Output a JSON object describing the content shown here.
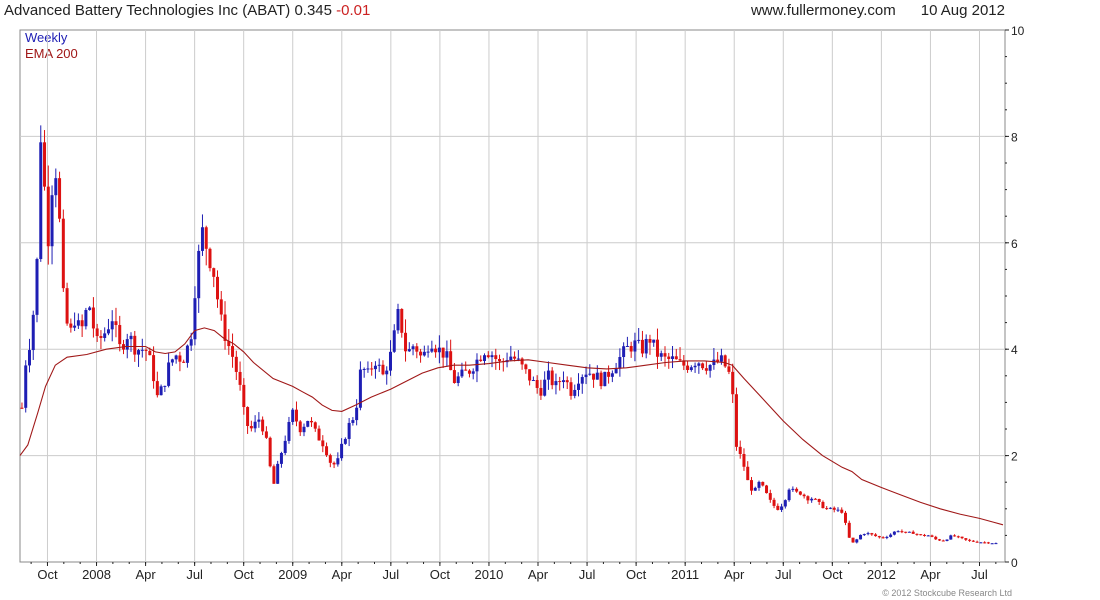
{
  "header": {
    "company": "Advanced Battery Technologies Inc (ABAT)",
    "price": "0.345",
    "change": "-0.01",
    "website": "www.fullermoney.com",
    "date": "10 Aug 2012"
  },
  "legend": {
    "period": "Weekly",
    "ema": "EMA 200"
  },
  "copyright": "© 2012 Stockcube Research Ltd",
  "colors": {
    "up": "#1e1eb4",
    "down": "#dd1111",
    "ema": "#a01818",
    "grid": "#cccccc",
    "axis": "#222222"
  },
  "chart_data": {
    "type": "candlestick",
    "series": [
      {
        "name": "Weekly",
        "kind": "ohlc"
      },
      {
        "name": "EMA 200",
        "kind": "line"
      }
    ],
    "y_axis": {
      "side": "right",
      "min": 0,
      "max": 10,
      "ticks": [
        0,
        2,
        4,
        6,
        8,
        10
      ]
    },
    "x_axis": {
      "ticks": [
        {
          "label": "Oct",
          "year": 2007.75
        },
        {
          "label": "2008",
          "year": 2008.0
        },
        {
          "label": "Apr",
          "year": 2008.25
        },
        {
          "label": "Jul",
          "year": 2008.5
        },
        {
          "label": "Oct",
          "year": 2008.75
        },
        {
          "label": "2009",
          "year": 2009.0
        },
        {
          "label": "Apr",
          "year": 2009.25
        },
        {
          "label": "Jul",
          "year": 2009.5
        },
        {
          "label": "Oct",
          "year": 2009.75
        },
        {
          "label": "2010",
          "year": 2010.0
        },
        {
          "label": "Apr",
          "year": 2010.25
        },
        {
          "label": "Jul",
          "year": 2010.5
        },
        {
          "label": "Oct",
          "year": 2010.75
        },
        {
          "label": "2011",
          "year": 2011.0
        },
        {
          "label": "Apr",
          "year": 2011.25
        },
        {
          "label": "Jul",
          "year": 2011.5
        },
        {
          "label": "Oct",
          "year": 2011.75
        },
        {
          "label": "2012",
          "year": 2012.0
        },
        {
          "label": "Apr",
          "year": 2012.25
        },
        {
          "label": "Jul",
          "year": 2012.5
        }
      ]
    },
    "close_path": [
      [
        2007.62,
        2.9
      ],
      [
        2007.64,
        3.8
      ],
      [
        2007.67,
        4.3
      ],
      [
        2007.7,
        5.8
      ],
      [
        2007.71,
        8.3
      ],
      [
        2007.73,
        7.4
      ],
      [
        2007.75,
        5.9
      ],
      [
        2007.77,
        7.0
      ],
      [
        2007.79,
        7.5
      ],
      [
        2007.81,
        6.5
      ],
      [
        2007.83,
        5.0
      ],
      [
        2007.86,
        4.2
      ],
      [
        2007.89,
        4.6
      ],
      [
        2007.92,
        4.3
      ],
      [
        2007.96,
        4.9
      ],
      [
        2008.0,
        4.1
      ],
      [
        2008.04,
        4.3
      ],
      [
        2008.08,
        4.6
      ],
      [
        2008.12,
        4.0
      ],
      [
        2008.16,
        4.3
      ],
      [
        2008.2,
        4.0
      ],
      [
        2008.25,
        4.0
      ],
      [
        2008.28,
        3.7
      ],
      [
        2008.31,
        3.1
      ],
      [
        2008.34,
        3.3
      ],
      [
        2008.37,
        3.7
      ],
      [
        2008.4,
        3.9
      ],
      [
        2008.44,
        3.8
      ],
      [
        2008.48,
        4.2
      ],
      [
        2008.51,
        5.5
      ],
      [
        2008.54,
        6.2
      ],
      [
        2008.57,
        5.8
      ],
      [
        2008.6,
        5.4
      ],
      [
        2008.63,
        4.6
      ],
      [
        2008.66,
        4.2
      ],
      [
        2008.7,
        3.8
      ],
      [
        2008.73,
        3.3
      ],
      [
        2008.76,
        2.6
      ],
      [
        2008.79,
        2.5
      ],
      [
        2008.83,
        2.7
      ],
      [
        2008.86,
        2.4
      ],
      [
        2008.9,
        1.4
      ],
      [
        2008.93,
        1.9
      ],
      [
        2008.96,
        2.3
      ],
      [
        2009.0,
        2.8
      ],
      [
        2009.04,
        2.5
      ],
      [
        2009.08,
        2.7
      ],
      [
        2009.12,
        2.4
      ],
      [
        2009.16,
        2.2
      ],
      [
        2009.2,
        1.8
      ],
      [
        2009.23,
        1.9
      ],
      [
        2009.26,
        2.3
      ],
      [
        2009.29,
        2.6
      ],
      [
        2009.32,
        2.8
      ],
      [
        2009.35,
        3.7
      ],
      [
        2009.38,
        3.5
      ],
      [
        2009.42,
        3.8
      ],
      [
        2009.46,
        3.5
      ],
      [
        2009.5,
        3.9
      ],
      [
        2009.54,
        4.7
      ],
      [
        2009.58,
        3.9
      ],
      [
        2009.62,
        4.1
      ],
      [
        2009.66,
        3.8
      ],
      [
        2009.7,
        4.2
      ],
      [
        2009.74,
        4.0
      ],
      [
        2009.78,
        3.9
      ],
      [
        2009.82,
        3.4
      ],
      [
        2009.86,
        3.5
      ],
      [
        2009.9,
        3.6
      ],
      [
        2009.94,
        3.8
      ],
      [
        2009.98,
        4.0
      ],
      [
        2010.02,
        3.9
      ],
      [
        2010.06,
        3.7
      ],
      [
        2010.1,
        3.9
      ],
      [
        2010.14,
        3.8
      ],
      [
        2010.18,
        3.6
      ],
      [
        2010.22,
        3.4
      ],
      [
        2010.26,
        3.2
      ],
      [
        2010.3,
        3.5
      ],
      [
        2010.34,
        3.3
      ],
      [
        2010.38,
        3.5
      ],
      [
        2010.42,
        3.2
      ],
      [
        2010.46,
        3.5
      ],
      [
        2010.5,
        3.6
      ],
      [
        2010.54,
        3.5
      ],
      [
        2010.58,
        3.4
      ],
      [
        2010.62,
        3.6
      ],
      [
        2010.66,
        3.8
      ],
      [
        2010.7,
        4.0
      ],
      [
        2010.74,
        4.1
      ],
      [
        2010.78,
        4.0
      ],
      [
        2010.82,
        4.2
      ],
      [
        2010.86,
        3.9
      ],
      [
        2010.9,
        3.8
      ],
      [
        2010.94,
        3.8
      ],
      [
        2010.98,
        3.7
      ],
      [
        2011.02,
        3.7
      ],
      [
        2011.06,
        3.8
      ],
      [
        2011.1,
        3.7
      ],
      [
        2011.14,
        3.7
      ],
      [
        2011.18,
        3.8
      ],
      [
        2011.22,
        3.6
      ],
      [
        2011.24,
        3.2
      ],
      [
        2011.26,
        2.2
      ],
      [
        2011.28,
        2.0
      ],
      [
        2011.3,
        1.8
      ],
      [
        2011.32,
        1.5
      ],
      [
        2011.35,
        1.3
      ],
      [
        2011.38,
        1.5
      ],
      [
        2011.41,
        1.3
      ],
      [
        2011.44,
        1.1
      ],
      [
        2011.47,
        1.0
      ],
      [
        2011.5,
        1.1
      ],
      [
        2011.53,
        1.4
      ],
      [
        2011.56,
        1.3
      ],
      [
        2011.59,
        1.3
      ],
      [
        2011.62,
        1.2
      ],
      [
        2011.65,
        1.2
      ],
      [
        2011.68,
        1.1
      ],
      [
        2011.72,
        1.0
      ],
      [
        2011.76,
        0.98
      ],
      [
        2011.8,
        0.95
      ],
      [
        2011.84,
        0.4
      ],
      [
        2011.86,
        0.35
      ],
      [
        2011.89,
        0.5
      ],
      [
        2011.92,
        0.55
      ],
      [
        2011.96,
        0.5
      ],
      [
        2012.0,
        0.45
      ],
      [
        2012.04,
        0.5
      ],
      [
        2012.08,
        0.6
      ],
      [
        2012.12,
        0.55
      ],
      [
        2012.16,
        0.55
      ],
      [
        2012.2,
        0.5
      ],
      [
        2012.24,
        0.5
      ],
      [
        2012.28,
        0.42
      ],
      [
        2012.32,
        0.4
      ],
      [
        2012.36,
        0.5
      ],
      [
        2012.4,
        0.45
      ],
      [
        2012.44,
        0.4
      ],
      [
        2012.48,
        0.38
      ],
      [
        2012.52,
        0.37
      ],
      [
        2012.56,
        0.36
      ],
      [
        2012.6,
        0.345
      ]
    ],
    "ema_200": [
      [
        2007.61,
        2.0
      ],
      [
        2007.65,
        2.2
      ],
      [
        2007.7,
        2.8
      ],
      [
        2007.74,
        3.3
      ],
      [
        2007.79,
        3.7
      ],
      [
        2007.85,
        3.85
      ],
      [
        2007.95,
        3.9
      ],
      [
        2008.05,
        4.0
      ],
      [
        2008.15,
        4.05
      ],
      [
        2008.25,
        4.05
      ],
      [
        2008.3,
        3.95
      ],
      [
        2008.35,
        3.92
      ],
      [
        2008.4,
        3.95
      ],
      [
        2008.45,
        4.1
      ],
      [
        2008.5,
        4.35
      ],
      [
        2008.55,
        4.4
      ],
      [
        2008.6,
        4.35
      ],
      [
        2008.65,
        4.2
      ],
      [
        2008.7,
        4.1
      ],
      [
        2008.75,
        3.95
      ],
      [
        2008.8,
        3.75
      ],
      [
        2008.9,
        3.45
      ],
      [
        2009.0,
        3.3
      ],
      [
        2009.05,
        3.2
      ],
      [
        2009.1,
        3.1
      ],
      [
        2009.15,
        2.95
      ],
      [
        2009.2,
        2.85
      ],
      [
        2009.25,
        2.83
      ],
      [
        2009.32,
        2.95
      ],
      [
        2009.4,
        3.1
      ],
      [
        2009.5,
        3.25
      ],
      [
        2009.58,
        3.4
      ],
      [
        2009.66,
        3.55
      ],
      [
        2009.74,
        3.65
      ],
      [
        2009.82,
        3.7
      ],
      [
        2009.9,
        3.7
      ],
      [
        2010.0,
        3.73
      ],
      [
        2010.1,
        3.78
      ],
      [
        2010.2,
        3.8
      ],
      [
        2010.3,
        3.75
      ],
      [
        2010.4,
        3.7
      ],
      [
        2010.5,
        3.65
      ],
      [
        2010.6,
        3.63
      ],
      [
        2010.7,
        3.65
      ],
      [
        2010.8,
        3.7
      ],
      [
        2010.9,
        3.75
      ],
      [
        2011.0,
        3.78
      ],
      [
        2011.1,
        3.78
      ],
      [
        2011.2,
        3.75
      ],
      [
        2011.24,
        3.7
      ],
      [
        2011.3,
        3.45
      ],
      [
        2011.4,
        3.05
      ],
      [
        2011.5,
        2.65
      ],
      [
        2011.6,
        2.3
      ],
      [
        2011.7,
        2.0
      ],
      [
        2011.8,
        1.78
      ],
      [
        2011.85,
        1.7
      ],
      [
        2011.9,
        1.55
      ],
      [
        2012.0,
        1.4
      ],
      [
        2012.1,
        1.26
      ],
      [
        2012.2,
        1.12
      ],
      [
        2012.3,
        1.0
      ],
      [
        2012.4,
        0.9
      ],
      [
        2012.5,
        0.82
      ],
      [
        2012.57,
        0.75
      ],
      [
        2012.62,
        0.7
      ]
    ]
  }
}
